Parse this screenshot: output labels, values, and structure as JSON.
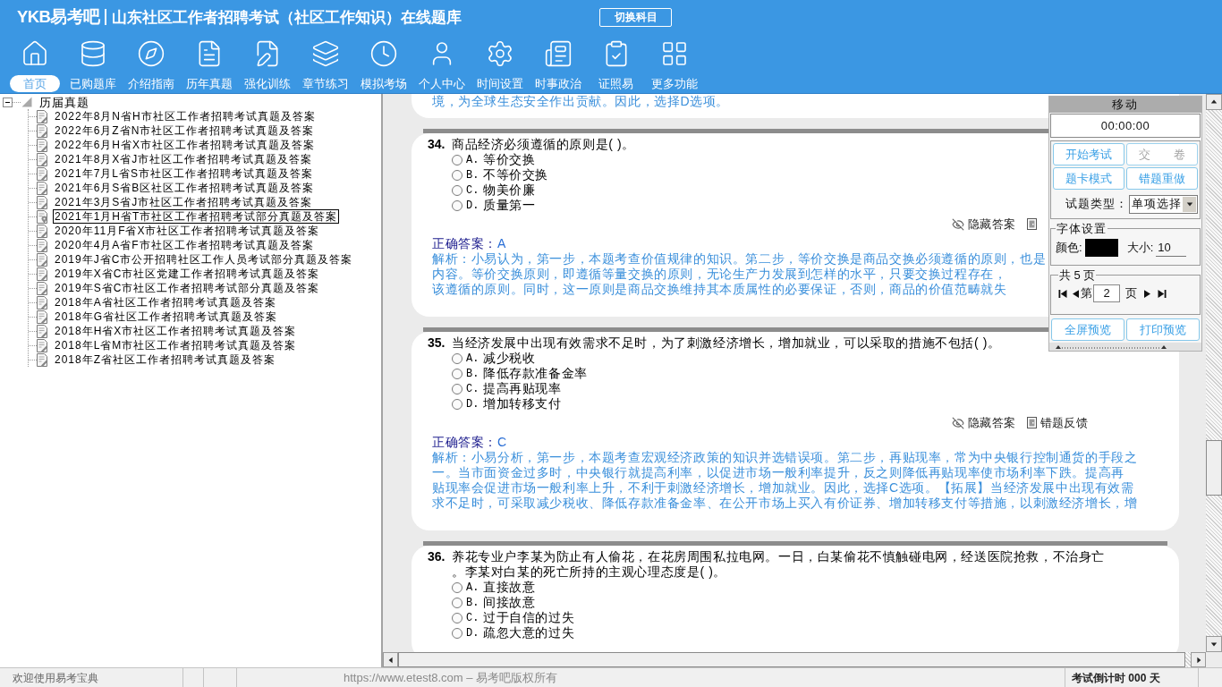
{
  "header": {
    "logo": "YKB易考吧",
    "title": "山东社区工作者招聘考试（社区工作知识）在线题库",
    "switch_button": "切换科目"
  },
  "toolbar": [
    {
      "label": "首页",
      "selected": true
    },
    {
      "label": "已购题库",
      "selected": false
    },
    {
      "label": "介绍指南",
      "selected": false
    },
    {
      "label": "历年真题",
      "selected": false
    },
    {
      "label": "强化训练",
      "selected": false
    },
    {
      "label": "章节练习",
      "selected": false
    },
    {
      "label": "模拟考场",
      "selected": false
    },
    {
      "label": "个人中心",
      "selected": false
    },
    {
      "label": "时间设置",
      "selected": false
    },
    {
      "label": "时事政治",
      "selected": false
    },
    {
      "label": "证照易",
      "selected": false
    },
    {
      "label": "更多功能",
      "selected": false
    }
  ],
  "tree": {
    "label": "历届真题",
    "expanded": true,
    "children": [
      {
        "label": "2022年8月N省H市社区工作者招聘考试真题及答案",
        "selected": false
      },
      {
        "label": "2022年6月Z省N市社区工作者招聘考试真题及答案",
        "selected": false
      },
      {
        "label": "2022年6月H省X市社区工作者招聘考试真题及答案",
        "selected": false
      },
      {
        "label": "2021年8月X省J市社区工作者招聘考试真题及答案",
        "selected": false
      },
      {
        "label": "2021年7月L省S市社区工作者招聘考试真题及答案",
        "selected": false
      },
      {
        "label": "2021年6月S省B区社区工作者招聘考试真题及答案",
        "selected": false
      },
      {
        "label": "2021年3月S省J市社区工作者招聘考试真题及答案",
        "selected": false
      },
      {
        "label": "2021年1月H省T市社区工作者招聘考试部分真题及答案",
        "selected": true
      },
      {
        "label": "2020年11月F省X市社区工作者招聘考试真题及答案",
        "selected": false
      },
      {
        "label": "2020年4月A省F市社区工作者招聘考试真题及答案",
        "selected": false
      },
      {
        "label": "2019年J省C市公开招聘社区工作人员考试部分真题及答案",
        "selected": false
      },
      {
        "label": "2019年X省C市社区党建工作者招聘考试真题及答案",
        "selected": false
      },
      {
        "label": "2019年S省C市社区工作者招聘考试部分真题及答案",
        "selected": false
      },
      {
        "label": "2018年A省社区工作者招聘考试真题及答案",
        "selected": false
      },
      {
        "label": "2018年G省社区工作者招聘考试真题及答案",
        "selected": false
      },
      {
        "label": "2018年H省X市社区工作者招聘考试真题及答案",
        "selected": false
      },
      {
        "label": "2018年L省M市社区工作者招聘考试真题及答案",
        "selected": false
      },
      {
        "label": "2018年Z省社区工作者招聘考试真题及答案",
        "selected": false
      }
    ]
  },
  "content": {
    "previous_explanation_tail": "境，为全球生态安全作出贡献。因此，选择D选项。",
    "questions": [
      {
        "number": "34.",
        "stem": "商品经济必须遵循的原则是( )。",
        "options": [
          {
            "letter": "A.",
            "text": "等价交换",
            "selected": false
          },
          {
            "letter": "B.",
            "text": "不等价交换",
            "selected": false
          },
          {
            "letter": "C.",
            "text": "物美价廉",
            "selected": false
          },
          {
            "letter": "D.",
            "text": "质量第一",
            "selected": false
          }
        ],
        "actions": [
          {
            "kind": "hide_answer",
            "label": "隐藏答案"
          },
          {
            "kind": "feedback"
          }
        ],
        "answer_label": "正确答案：",
        "answer": "A",
        "explanation": [
          "解析：小易认为，第一步，本题考查价值规律的知识。第二步，等价交换是商品交换必须遵循的原则，也是",
          "内容。等价交换原则，即遵循等量交换的原则，无论生产力发展到怎样的水平，只要交换过程存在，",
          "该遵循的原则。同时，这一原则是商品交换维持其本质属性的必要保证，否则，商品的价值范畴就失"
        ]
      },
      {
        "number": "35.",
        "stem": "当经济发展中出现有效需求不足时，为了刺激经济增长，增加就业，可以采取的措施不包括( )。",
        "options": [
          {
            "letter": "A.",
            "text": "减少税收",
            "selected": false
          },
          {
            "letter": "B.",
            "text": "降低存款准备金率",
            "selected": false
          },
          {
            "letter": "C.",
            "text": "提高再贴现率",
            "selected": false
          },
          {
            "letter": "D.",
            "text": "增加转移支付",
            "selected": false
          }
        ],
        "actions": [
          {
            "kind": "hide_answer",
            "label": "隐藏答案"
          },
          {
            "kind": "feedback",
            "label": "错题反馈"
          }
        ],
        "answer_label": "正确答案：",
        "answer": "C",
        "explanation": [
          "解析：小易分析，第一步，本题考查宏观经济政策的知识并选错误项。第二步，再贴现率，常为中央银行控制通货的手段之",
          "一。当市面资金过多时，中央银行就提高利率，以促进市场一般利率提升，反之则降低再贴现率使市场利率下跌。提高再",
          "贴现率会促进市场一般利率上升，不利于刺激经济增长，增加就业。因此，选择C选项。【拓展】当经济发展中出现有效需",
          "求不足时，可采取减少税收、降低存款准备金率、在公开市场上买入有价证券、增加转移支付等措施，以刺激经济增长，增"
        ]
      },
      {
        "number": "36.",
        "stem": "养花专业户李某为防止有人偷花，在花房周围私拉电网。一日，白某偷花不慎触碰电网，经送医院抢救，不治身亡。李某对白某的死亡所持的主观心理态度是( )。",
        "options": [
          {
            "letter": "A.",
            "text": "直接故意",
            "selected": false
          },
          {
            "letter": "B.",
            "text": "间接故意",
            "selected": false
          },
          {
            "letter": "C.",
            "text": "过于自信的过失",
            "selected": false
          },
          {
            "letter": "D.",
            "text": "疏忽大意的过失",
            "selected": false
          }
        ]
      }
    ]
  },
  "floating_panel": {
    "title": "移动",
    "timer": "00:00:00",
    "buttons": [
      {
        "label": "开始考试",
        "disabled": false
      },
      {
        "label": "交　　卷",
        "disabled": true
      },
      {
        "label": "题卡模式",
        "disabled": false
      },
      {
        "label": "错题重做",
        "disabled": false
      }
    ],
    "question_type": {
      "label": "试题类型：",
      "value": "单项选择"
    },
    "font_settings": {
      "title": "字体设置",
      "color_label": "颜色:",
      "color": "#000000",
      "size_label": "大小:",
      "size": "10"
    },
    "pager": {
      "title": "共 5 页",
      "before": "第",
      "page": "2",
      "after": "页"
    },
    "preview_buttons": [
      "全屏预览",
      "打印预览"
    ]
  },
  "status_bar": {
    "welcome": "欢迎使用易考宝典",
    "copyright": "https://www.etest8.com – 易考吧版权所有",
    "countdown": "考试倒计时 000 天"
  }
}
